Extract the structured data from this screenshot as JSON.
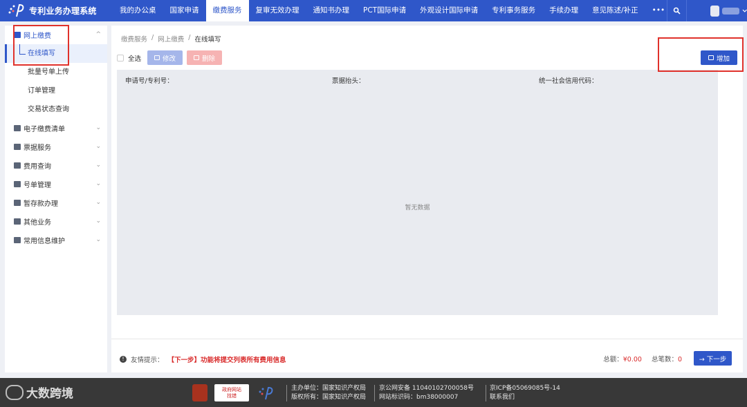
{
  "app": {
    "title": "专利业务办理系统"
  },
  "nav": [
    {
      "label": "我的办公桌",
      "active": false
    },
    {
      "label": "国家申请",
      "active": false
    },
    {
      "label": "缴费服务",
      "active": true
    },
    {
      "label": "复审无效办理",
      "active": false
    },
    {
      "label": "通知书办理",
      "active": false
    },
    {
      "label": "PCT国际申请",
      "active": false
    },
    {
      "label": "外观设计国际申请",
      "active": false
    },
    {
      "label": "专利事务服务",
      "active": false
    },
    {
      "label": "手续办理",
      "active": false
    },
    {
      "label": "意见陈述/补正",
      "active": false
    },
    {
      "label": "•••",
      "active": false
    }
  ],
  "sidebar": {
    "open_group": "网上缴费",
    "open_group_chevron": "^",
    "sub_items": [
      "在线填写",
      "批量号单上传",
      "订单管理",
      "交易状态查询"
    ],
    "groups": [
      "电子缴费清单",
      "票据服务",
      "费用查询",
      "号单管理",
      "暂存款办理",
      "其他业务",
      "常用信息维护"
    ],
    "group_chevron": "⌄"
  },
  "breadcrumb": [
    "缴费服务",
    "网上缴费",
    "在线填写"
  ],
  "breadcrumb_sep": "/",
  "toolbar": {
    "select_all": "全选",
    "edit": "修改",
    "delete": "删除",
    "add": "增加"
  },
  "table": {
    "headers": [
      "申请号/专利号：",
      "票据抬头：",
      "统一社会信用代码："
    ],
    "empty_text": "暂无数据"
  },
  "footer_bar": {
    "tip_label": "友情提示：",
    "tip_text": "【下一步】功能将提交列表所有费用信息",
    "total_amount_label": "总额：",
    "total_amount": "¥0.00",
    "total_count_label": "总笔数：",
    "total_count": "0",
    "next": "→ 下一步"
  },
  "site_footer": {
    "watermark": "大数跨境",
    "badge_text": [
      "政府网站",
      "找错"
    ],
    "sponsor": "主办单位：国家知识产权局",
    "copyright": "版权所有：国家知识产权局",
    "police": "京公网安备 11040102700058号",
    "site_code": "网站标识码：bm38000007",
    "icp": "京ICP备05069085号-14",
    "contact": "联系我们"
  },
  "colors": {
    "primary": "#2f57c9",
    "highlight": "#e0312b",
    "danger": "#d92c2c"
  }
}
